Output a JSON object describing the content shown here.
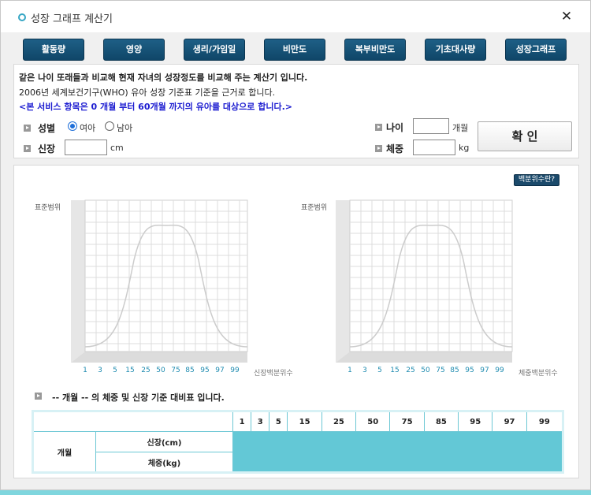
{
  "window": {
    "title": "성장 그래프 계산기",
    "close_label": "✕"
  },
  "tabs": [
    "활동량",
    "영양",
    "생리/가임일",
    "비만도",
    "복부비만도",
    "기초대사량",
    "성장그래프"
  ],
  "info": {
    "line1": "같은 나이 또래들과 비교해 현재 자녀의 성장정도를 비교해 주는 계산기 입니다.",
    "line2": "2006년 세계보건기구(WHO) 유아 성장 기준표 기준을 근거로 합니다.",
    "line3": "<본 서비스 항목은 0 개월 부터 60개월 까지의 유아를 대상으로 합니다.>"
  },
  "form": {
    "gender_label": "성별",
    "gender_options": [
      "여아",
      "남아"
    ],
    "gender_selected": "여아",
    "height_label": "신장",
    "height_value": "",
    "height_unit": "cm",
    "age_label": "나이",
    "age_value": "",
    "age_unit": "개월",
    "weight_label": "체중",
    "weight_value": "",
    "weight_unit": "kg",
    "confirm_label": "확 인"
  },
  "charts": {
    "percentile_button": "백분위수란?",
    "left": {
      "ylabel": "표준범위",
      "xlabel": "신장백분위수"
    },
    "right": {
      "ylabel": "표준범위",
      "xlabel": "체중백분위수"
    },
    "x_ticks": [
      "1",
      "3",
      "5",
      "15",
      "25",
      "50",
      "75",
      "85",
      "95",
      "97",
      "99"
    ]
  },
  "table": {
    "title": "-- 개월 -- 의 체중 및 신장 기준 대비표 입니다.",
    "percentiles": [
      "1",
      "3",
      "5",
      "15",
      "25",
      "50",
      "75",
      "85",
      "95",
      "97",
      "99"
    ],
    "row_header": "개월",
    "rows": [
      "신장(cm)",
      "체중(kg)"
    ]
  },
  "colors": {
    "tab_bg": "#1e5f86",
    "accent": "#63c8d6",
    "notice": "#1b1bd0"
  }
}
